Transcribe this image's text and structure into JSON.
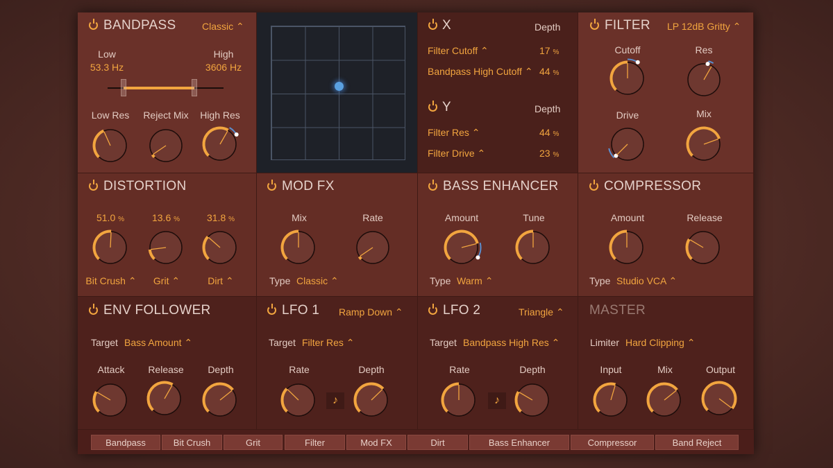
{
  "colors": {
    "accent": "#f2a53f",
    "modulation": "#5a8fd0",
    "xy_dot": "#5aa0e0"
  },
  "bandpass": {
    "title": "BANDPASS",
    "mode": "Classic ⌃",
    "low_label": "Low",
    "low_value": "53.3 Hz",
    "high_label": "High",
    "high_value": "3606 Hz",
    "knobs": [
      {
        "label": "Low Res",
        "value": 0.41
      },
      {
        "label": "Reject Mix",
        "value": 0.04
      },
      {
        "label": "High Res",
        "value": 0.61,
        "mod": 0.72
      }
    ]
  },
  "x_mod": {
    "title": "X",
    "depth_label": "Depth",
    "rows": [
      {
        "target": "Filter Cutoff ⌃",
        "depth": "17",
        "unit": "%"
      },
      {
        "target": "Bandpass High Cutoff ⌃",
        "depth": "44",
        "unit": "%"
      }
    ]
  },
  "y_mod": {
    "title": "Y",
    "depth_label": "Depth",
    "rows": [
      {
        "target": "Filter Res ⌃",
        "depth": "44",
        "unit": "%"
      },
      {
        "target": "Filter Drive ⌃",
        "depth": "23",
        "unit": "%"
      }
    ]
  },
  "filter": {
    "title": "FILTER",
    "mode": "LP 12dB Gritty ⌃",
    "knobs": [
      {
        "label": "Cutoff",
        "value": 0.5,
        "mod": 0.62
      },
      {
        "label": "Res",
        "value": 0.61,
        "mod": 0.55,
        "modonly": true
      },
      {
        "label": "Drive",
        "value": 0.0,
        "mod": 0.12,
        "modonly": true
      },
      {
        "label": "Mix",
        "value": 0.76
      }
    ]
  },
  "distortion": {
    "title": "DISTORTION",
    "knobs": [
      {
        "value_text": "51.0",
        "unit": "%",
        "label": "Bit Crush ⌃",
        "value": 0.51
      },
      {
        "value_text": "13.6",
        "unit": "%",
        "label": "Grit ⌃",
        "value": 0.14
      },
      {
        "value_text": "31.8",
        "unit": "%",
        "label": "Dirt ⌃",
        "value": 0.32
      }
    ]
  },
  "mod_fx": {
    "title": "MOD FX",
    "type_label": "Type",
    "type_value": "Classic ⌃",
    "knobs": [
      {
        "label": "Mix",
        "value": 0.5
      },
      {
        "label": "Rate",
        "value": 0.04
      }
    ]
  },
  "bass_enhancer": {
    "title": "BASS ENHANCER",
    "type_label": "Type",
    "type_value": "Warm ⌃",
    "knobs": [
      {
        "label": "Amount",
        "value": 0.78,
        "mod": 0.95
      },
      {
        "label": "Tune",
        "value": 0.5
      }
    ]
  },
  "compressor": {
    "title": "COMPRESSOR",
    "type_label": "Type",
    "type_value": "Studio VCA ⌃",
    "knobs": [
      {
        "label": "Amount",
        "value": 0.5
      },
      {
        "label": "Release",
        "value": 0.28
      }
    ]
  },
  "env_follower": {
    "title": "ENV FOLLOWER",
    "target_label": "Target",
    "target_value": "Bass Amount ⌃",
    "knobs": [
      {
        "label": "Attack",
        "value": 0.28
      },
      {
        "label": "Release",
        "value": 0.61
      },
      {
        "label": "Depth",
        "value": 0.69
      }
    ]
  },
  "lfo1": {
    "title": "LFO 1",
    "shape": "Ramp Down ⌃",
    "target_label": "Target",
    "target_value": "Filter Res ⌃",
    "sync_icon": "♪",
    "knobs": [
      {
        "label": "Rate",
        "value": 0.33
      },
      {
        "label": "Depth",
        "value": 0.67
      }
    ]
  },
  "lfo2": {
    "title": "LFO 2",
    "shape": "Triangle ⌃",
    "target_label": "Target",
    "target_value": "Bandpass High Res ⌃",
    "sync_icon": "♪",
    "knobs": [
      {
        "label": "Rate",
        "value": 0.5
      },
      {
        "label": "Depth",
        "value": 0.28
      }
    ]
  },
  "master": {
    "title": "MASTER",
    "limiter_label": "Limiter",
    "limiter_value": "Hard Clipping ⌃",
    "knobs": [
      {
        "label": "Input",
        "value": 0.56
      },
      {
        "label": "Mix",
        "value": 0.69
      },
      {
        "label": "Output",
        "value": 0.97
      }
    ]
  },
  "order_bar": [
    "Bandpass",
    "Bit Crush",
    "Grit",
    "Filter",
    "Mod FX",
    "Dirt",
    "Bass Enhancer",
    "Compressor",
    "Band Reject"
  ]
}
